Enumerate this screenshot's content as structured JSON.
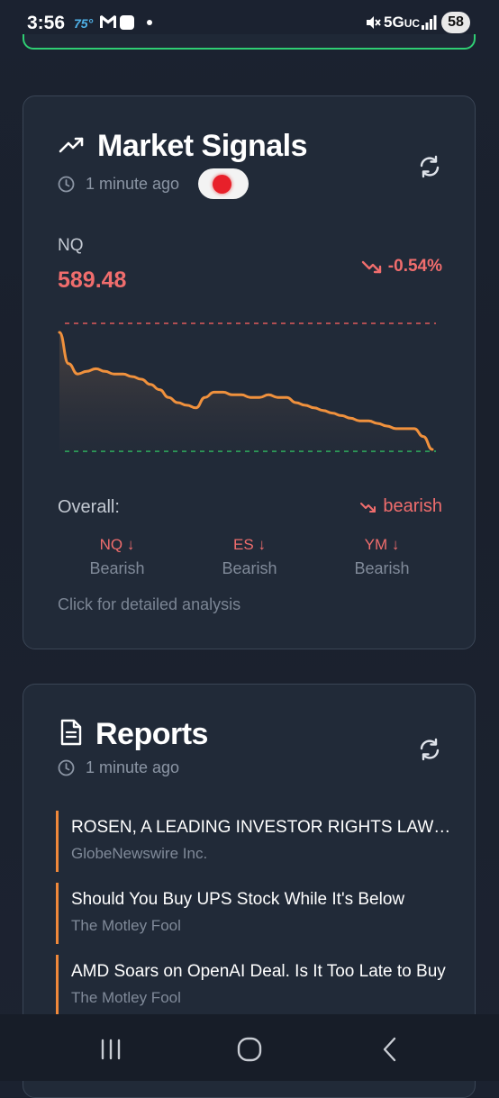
{
  "status_bar": {
    "time": "3:56",
    "temperature": "75°",
    "network": "5G",
    "network_suffix": "UC",
    "battery": "58",
    "icons": [
      "gmail-icon",
      "news-icon",
      "notification-dot-icon",
      "mute-icon",
      "signal-icon"
    ]
  },
  "market_signals": {
    "title": "Market Signals",
    "updated": "1 minute ago",
    "live_indicator_color": "#e8202a",
    "symbol": "NQ",
    "price": "589.48",
    "change": "-0.54%",
    "chart": {
      "line_color": "#f0913d",
      "upper_band_color": "#e05a5a",
      "lower_band_color": "#2fbf62",
      "series": [
        589.95,
        589.83,
        589.79,
        589.8,
        589.81,
        589.8,
        589.79,
        589.79,
        589.78,
        589.77,
        589.75,
        589.73,
        589.7,
        589.68,
        589.67,
        589.66,
        589.7,
        589.72,
        589.72,
        589.71,
        589.71,
        589.7,
        589.7,
        589.71,
        589.7,
        589.7,
        589.68,
        589.67,
        589.66,
        589.65,
        589.64,
        589.63,
        589.62,
        589.61,
        589.61,
        589.6,
        589.59,
        589.58,
        589.58,
        589.58,
        589.55,
        589.5
      ]
    },
    "overall_label": "Overall:",
    "overall_value": "bearish",
    "indices": [
      {
        "name": "NQ ↓",
        "sentiment": "Bearish"
      },
      {
        "name": "ES ↓",
        "sentiment": "Bearish"
      },
      {
        "name": "YM ↓",
        "sentiment": "Bearish"
      }
    ],
    "detail_link": "Click for detailed analysis"
  },
  "reports": {
    "title": "Reports",
    "updated": "1 minute ago",
    "items": [
      {
        "title": "ROSEN, A LEADING INVESTOR RIGHTS LAW FIRM",
        "source": "GlobeNewswire Inc."
      },
      {
        "title": "Should You Buy UPS Stock While It's Below",
        "source": "The Motley Fool"
      },
      {
        "title": "AMD Soars on OpenAI Deal. Is It Too Late to Buy",
        "source": "The Motley Fool"
      }
    ],
    "accent_color": "#f0883a"
  },
  "navigation": {
    "buttons": [
      "recent-apps",
      "home",
      "back"
    ]
  }
}
